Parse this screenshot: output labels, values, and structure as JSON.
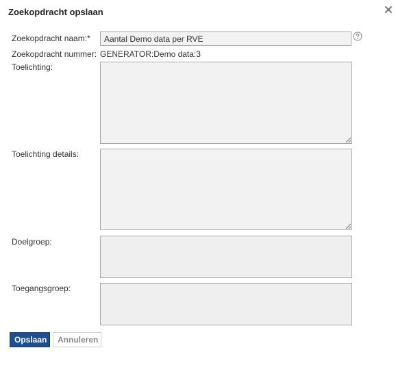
{
  "dialog": {
    "title": "Zoekopdracht opslaan",
    "close_icon": "close-icon"
  },
  "form": {
    "name_label": "Zoekopdracht naam:*",
    "name_value": "Aantal Demo data per RVE",
    "help_icon": "help-icon",
    "number_label": "Zoekopdracht nummer:",
    "number_value": "GENERATOR:Demo data:3",
    "explanation_label": "Toelichting:",
    "explanation_value": "",
    "details_label": "Toelichting details:",
    "details_value": "",
    "target_group_label": "Doelgroep:",
    "access_group_label": "Toegangsgroep:"
  },
  "buttons": {
    "save_label": "Opslaan",
    "cancel_label": "Annuleren"
  },
  "colors": {
    "primary_button": "#1d4e8f",
    "field_background": "#f2f2f2",
    "field_border": "#a9a9a9"
  }
}
